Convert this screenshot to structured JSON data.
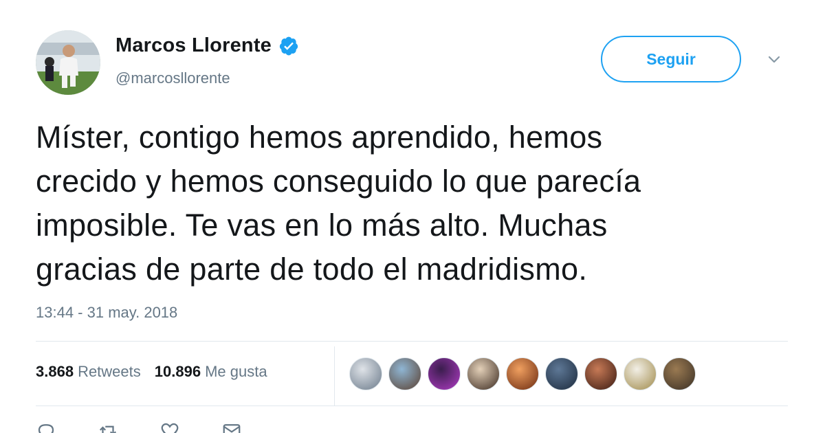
{
  "user": {
    "display_name": "Marcos Llorente",
    "handle": "@marcosllorente",
    "verified": true
  },
  "follow_button": {
    "label": "Seguir"
  },
  "tweet": {
    "lines": [
      "Míster, contigo hemos aprendido, hemos",
      "crecido y hemos conseguido lo que parecía",
      "imposible. Te vas en lo más alto. Muchas",
      "gracias de parte de todo el madridismo."
    ],
    "timestamp": "13:44 - 31 may. 2018"
  },
  "stats": {
    "retweets": {
      "count": "3.868",
      "label": "Retweets"
    },
    "likes": {
      "count": "10.896",
      "label": "Me gusta"
    }
  },
  "colors": {
    "accent": "#1da1f2",
    "text": "#14171a",
    "muted": "#657786",
    "divider": "#e1e8ed"
  },
  "liker_avatars": [
    {
      "colors": [
        "#dfe3e8",
        "#6b7a8a"
      ]
    },
    {
      "colors": [
        "#8fb6d4",
        "#5a4030"
      ]
    },
    {
      "colors": [
        "#3a1d4d",
        "#b03cc4"
      ]
    },
    {
      "colors": [
        "#e3d0b8",
        "#3b2a20"
      ]
    },
    {
      "colors": [
        "#f0a060",
        "#6b2a10"
      ]
    },
    {
      "colors": [
        "#5e7896",
        "#1c2a3c"
      ]
    },
    {
      "colors": [
        "#c77a56",
        "#3a1a12"
      ]
    },
    {
      "colors": [
        "#f2efe6",
        "#a08a4a"
      ]
    },
    {
      "colors": [
        "#9a7a52",
        "#3a2f24"
      ]
    }
  ],
  "actions": [
    {
      "icon": "reply-icon"
    },
    {
      "icon": "retweet-icon"
    },
    {
      "icon": "like-icon"
    },
    {
      "icon": "message-icon"
    }
  ]
}
